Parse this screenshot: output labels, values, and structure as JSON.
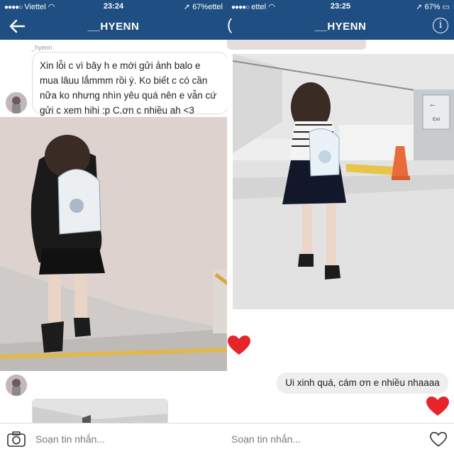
{
  "colors": {
    "header": "#1f4f82",
    "bubble_border": "#dedede",
    "bubble_out_bg": "#eeeeee",
    "heart": "#e8242b"
  },
  "left": {
    "status": {
      "carrier": "Viettel",
      "time": "23:24",
      "battery": "67%ettel"
    },
    "title": "__HYENN",
    "sender": "_hyenn",
    "message": "Xin lỗi c vì bây h e mới gửi ảnh balo e mua lâuu lắmmm rồi ý. Ko biết c có cần nữa ko nhưng nhìn yêu quá nên e vẫn cứ gửi c xem hihi :p C.ơn c nhiều ah <3",
    "composer_placeholder": "Soạn tin nhắn...",
    "icons": [
      "back-arrow-icon",
      "camera-icon"
    ]
  },
  "right": {
    "status": {
      "carrier": "ettel",
      "time": "23:25",
      "battery": "67%"
    },
    "title": "__HYENN",
    "back_glyph": "(",
    "sign_text": "Exit",
    "reply": "Ui xinh quá, cám ơn e nhiều nhaaaa",
    "composer_placeholder": "Soạn tin nhắn...",
    "icons": [
      "info-icon",
      "heart-icon"
    ]
  }
}
